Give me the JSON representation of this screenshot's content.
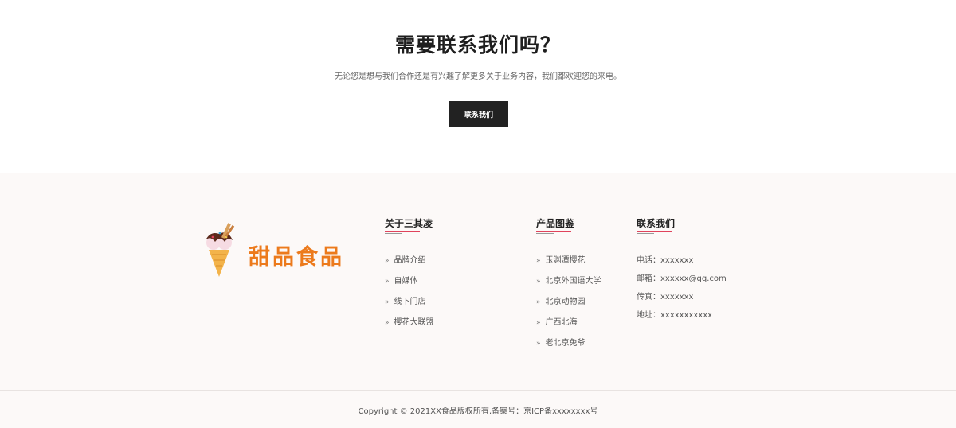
{
  "cta": {
    "title": "需要联系我们吗？",
    "subtitle": "无论您是想与我们合作还是有兴趣了解更多关于业务内容，我们都欢迎您的来电。",
    "button_label": "联系我们"
  },
  "footer": {
    "logo_text": "甜品食品",
    "about": {
      "title": "关于三其凌",
      "links": [
        "品牌介绍",
        "自媒体",
        "线下门店",
        "樱花大联盟"
      ]
    },
    "products": {
      "title": "产品图鉴",
      "links": [
        "玉渊潭樱花",
        "北京外国语大学",
        "北京动物园",
        "广西北海",
        "老北京兔爷"
      ]
    },
    "contact": {
      "title": "联系我们",
      "items": [
        "电话：xxxxxxx",
        "邮箱：xxxxxx@qq.com",
        "传真：xxxxxxx",
        "地址：xxxxxxxxxxx"
      ]
    },
    "copyright": "Copyright © 2021XX食品版权所有,备案号：京ICP备xxxxxxxx号"
  },
  "colors": {
    "accent_line": "#e0435c",
    "logo_orange": "#ec7a1c",
    "button_bg": "#222222",
    "footer_bg": "#fcf9f8"
  },
  "icons": {
    "logo": "ice-cream-cone-icon",
    "link_marker": "double-chevron-right-icon"
  }
}
